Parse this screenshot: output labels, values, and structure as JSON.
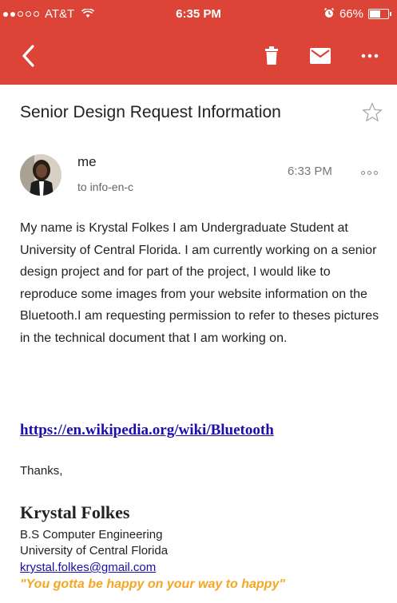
{
  "status_bar": {
    "carrier": "AT&T",
    "time": "6:35 PM",
    "battery": "66%",
    "battery_level": 0.66
  },
  "toolbar": {
    "back_icon": "back-chevron-icon",
    "trash_icon": "trash-icon",
    "mail_icon": "mail-icon",
    "more_icon": "more-dots-icon"
  },
  "colors": {
    "toolbar_bg": "#db4437",
    "link": "#1a0dab",
    "quote": "#f5a623"
  },
  "email": {
    "subject": "Senior Design Request Information",
    "sender": "me",
    "recipient": "to info-en-c",
    "time": "6:33 PM",
    "body": "My name is Krystal Folkes I am Undergraduate Student at University of Central Florida. I am currently working on a senior design project and for part of the project, I would like to reproduce some images from your website information on the Bluetooth.I am requesting permission to refer to theses pictures in the technical document that I am working on.",
    "link": "https://en.wikipedia.org/wiki/Bluetooth",
    "closing": "Thanks,",
    "signature": {
      "name": "Krystal Folkes",
      "degree": "B.S Computer Engineering",
      "university": "University of Central Florida",
      "email": "krystal.folkes@gmail.com",
      "quote": "\"You gotta be happy on your way to happy\""
    }
  }
}
